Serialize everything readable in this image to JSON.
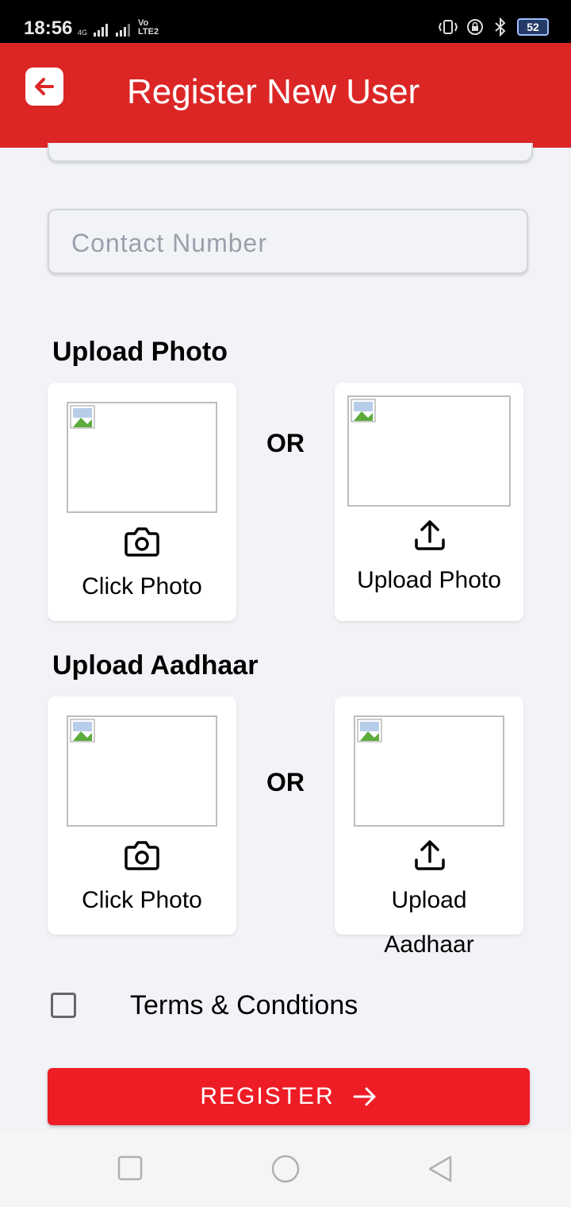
{
  "status_bar": {
    "time": "18:56",
    "network_left": "4G",
    "volte": "Vo",
    "lte": "LTE2",
    "battery": "52"
  },
  "app_bar": {
    "title": "Register New User",
    "back_icon": "arrow-left-icon",
    "color": "#dc2626"
  },
  "form": {
    "contact_placeholder": "Contact Number",
    "contact_value": ""
  },
  "photo_section": {
    "title": "Upload Photo",
    "left_label": "Click Photo",
    "left_icon": "camera-icon",
    "or_text": "OR",
    "right_label": "Upload Photo",
    "right_icon": "upload-icon"
  },
  "aadhaar_section": {
    "title": "Upload Aadhaar",
    "left_label": "Click Photo",
    "left_icon": "camera-icon",
    "or_text": "OR",
    "right_label": "Upload Aadhaar",
    "right_icon": "upload-icon"
  },
  "terms": {
    "label": "Terms & Condtions",
    "checked": false
  },
  "register_button": {
    "label": "REGISTER",
    "icon": "arrow-right-icon",
    "color": "#ee1c25"
  },
  "nav_bar": {
    "icons": [
      "recent-apps-icon",
      "home-icon",
      "back-icon"
    ]
  }
}
